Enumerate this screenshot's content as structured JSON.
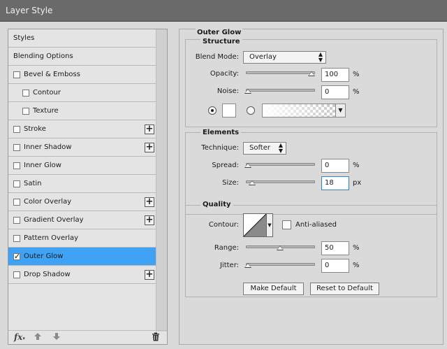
{
  "window": {
    "title": "Layer Style"
  },
  "styles_list": {
    "items": [
      {
        "label": "Styles",
        "checkbox": false,
        "checked": false,
        "plus": false,
        "indent": false,
        "active": false
      },
      {
        "label": "Blending Options",
        "checkbox": false,
        "checked": false,
        "plus": false,
        "indent": false,
        "active": false
      },
      {
        "label": "Bevel & Emboss",
        "checkbox": true,
        "checked": false,
        "plus": false,
        "indent": false,
        "active": false
      },
      {
        "label": "Contour",
        "checkbox": true,
        "checked": false,
        "plus": false,
        "indent": true,
        "active": false
      },
      {
        "label": "Texture",
        "checkbox": true,
        "checked": false,
        "plus": false,
        "indent": true,
        "active": false
      },
      {
        "label": "Stroke",
        "checkbox": true,
        "checked": false,
        "plus": true,
        "indent": false,
        "active": false
      },
      {
        "label": "Inner Shadow",
        "checkbox": true,
        "checked": false,
        "plus": true,
        "indent": false,
        "active": false
      },
      {
        "label": "Inner Glow",
        "checkbox": true,
        "checked": false,
        "plus": false,
        "indent": false,
        "active": false
      },
      {
        "label": "Satin",
        "checkbox": true,
        "checked": false,
        "plus": false,
        "indent": false,
        "active": false
      },
      {
        "label": "Color Overlay",
        "checkbox": true,
        "checked": false,
        "plus": true,
        "indent": false,
        "active": false
      },
      {
        "label": "Gradient Overlay",
        "checkbox": true,
        "checked": false,
        "plus": true,
        "indent": false,
        "active": false
      },
      {
        "label": "Pattern Overlay",
        "checkbox": true,
        "checked": false,
        "plus": false,
        "indent": false,
        "active": false
      },
      {
        "label": "Outer Glow",
        "checkbox": true,
        "checked": true,
        "plus": false,
        "indent": false,
        "active": true
      },
      {
        "label": "Drop Shadow",
        "checkbox": true,
        "checked": false,
        "plus": true,
        "indent": false,
        "active": false
      }
    ],
    "footer": {
      "fx_label": "fx",
      "up_icon": "arrow-up-icon",
      "down_icon": "arrow-down-icon",
      "trash_icon": "trash-icon"
    }
  },
  "panel": {
    "title": "Outer Glow",
    "structure": {
      "heading": "Structure",
      "blend_mode_label": "Blend Mode:",
      "blend_mode_value": "Overlay",
      "opacity_label": "Opacity:",
      "opacity_value": "100",
      "opacity_fraction": 1.0,
      "noise_label": "Noise:",
      "noise_value": "0",
      "noise_fraction": 0.0,
      "percent": "%",
      "glow_mode": "solid",
      "color": "#ffffff"
    },
    "elements": {
      "heading": "Elements",
      "technique_label": "Technique:",
      "technique_value": "Softer",
      "spread_label": "Spread:",
      "spread_value": "0",
      "spread_fraction": 0.0,
      "size_label": "Size:",
      "size_value": "18",
      "size_fraction": 0.07,
      "percent": "%",
      "px": "px"
    },
    "quality": {
      "heading": "Quality",
      "contour_label": "Contour:",
      "antialiased_label": "Anti-aliased",
      "antialiased": false,
      "range_label": "Range:",
      "range_value": "50",
      "range_fraction": 0.5,
      "jitter_label": "Jitter:",
      "jitter_value": "0",
      "jitter_fraction": 0.0,
      "percent": "%"
    },
    "make_default_label": "Make Default",
    "reset_default_label": "Reset to Default"
  },
  "colors": {
    "selection": "#3fa2f5",
    "dialog_bg": "#dadada",
    "titlebar_bg": "#6a6a6a"
  }
}
